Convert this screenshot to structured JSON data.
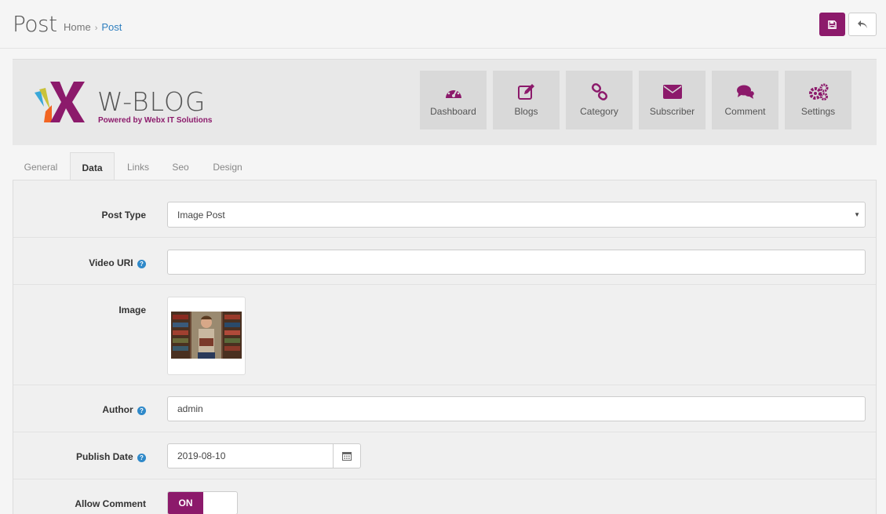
{
  "header": {
    "title": "Post",
    "breadcrumb": [
      "Home",
      "Post"
    ]
  },
  "logo": {
    "text": "W-BLOG",
    "subtitle": "Powered by Webx IT Solutions"
  },
  "nav": [
    {
      "label": "Dashboard",
      "icon": "dashboard-icon"
    },
    {
      "label": "Blogs",
      "icon": "edit-icon"
    },
    {
      "label": "Category",
      "icon": "link-icon"
    },
    {
      "label": "Subscriber",
      "icon": "envelope-icon"
    },
    {
      "label": "Comment",
      "icon": "comments-icon"
    },
    {
      "label": "Settings",
      "icon": "gears-icon"
    }
  ],
  "tabs": [
    "General",
    "Data",
    "Links",
    "Seo",
    "Design"
  ],
  "active_tab": "Data",
  "form": {
    "post_type": {
      "label": "Post Type",
      "value": "Image Post"
    },
    "video_uri": {
      "label": "Video URI",
      "value": ""
    },
    "image": {
      "label": "Image"
    },
    "author": {
      "label": "Author",
      "value": "admin"
    },
    "publish_date": {
      "label": "Publish Date",
      "value": "2019-08-10"
    },
    "allow_comment": {
      "label": "Allow Comment",
      "value": "ON"
    }
  },
  "colors": {
    "accent": "#8c1a6b",
    "link": "#2f7fbf",
    "help": "#2f89c9"
  }
}
